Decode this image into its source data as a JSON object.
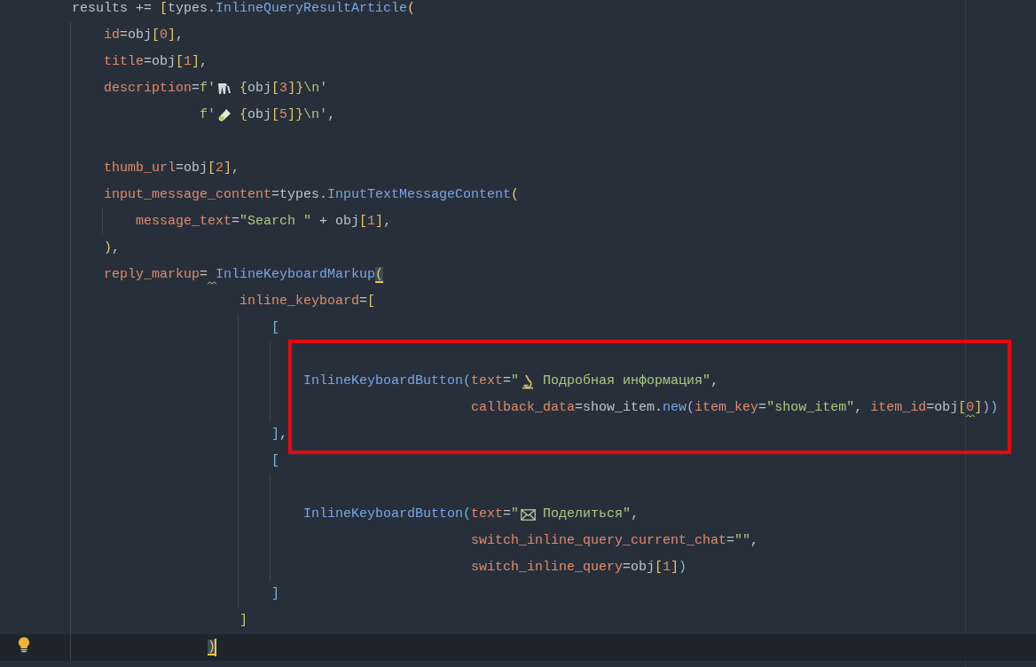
{
  "editor": {
    "lines": [
      {
        "kind": "code",
        "tokens": [
          {
            "t": "results += ",
            "kind": "plain"
          },
          {
            "t": "[",
            "kind": "b1"
          },
          {
            "t": "types.",
            "kind": "plain"
          },
          {
            "t": "InlineQueryResultArticle",
            "kind": "cls"
          },
          {
            "t": "(",
            "kind": "b1"
          }
        ]
      },
      {
        "kind": "code",
        "tokens": [
          {
            "t": "id",
            "kind": "param"
          },
          {
            "t": "=obj",
            "kind": "plain"
          },
          {
            "t": "[",
            "kind": "b1"
          },
          {
            "t": "0",
            "kind": "num"
          },
          {
            "t": "]",
            "kind": "b1"
          },
          {
            "t": ",",
            "kind": "plain"
          }
        ]
      },
      {
        "kind": "code",
        "tokens": [
          {
            "t": "title",
            "kind": "param"
          },
          {
            "t": "=obj",
            "kind": "plain"
          },
          {
            "t": "[",
            "kind": "b1"
          },
          {
            "t": "1",
            "kind": "num"
          },
          {
            "t": "]",
            "kind": "b1"
          },
          {
            "t": ",",
            "kind": "plain"
          }
        ]
      },
      {
        "kind": "code",
        "tokens": [
          {
            "t": "description",
            "kind": "param"
          },
          {
            "t": "=",
            "kind": "plain"
          },
          {
            "t": "f'",
            "kind": "str"
          },
          {
            "kind": "icon"
          },
          {
            "t": "{",
            "kind": "b1"
          },
          {
            "t": "obj",
            "kind": "plain"
          },
          {
            "t": "[",
            "kind": "b1"
          },
          {
            "t": "3",
            "kind": "num"
          },
          {
            "t": "]",
            "kind": "b1"
          },
          {
            "t": "}",
            "kind": "b1"
          },
          {
            "t": "\\n'",
            "kind": "str"
          }
        ]
      },
      {
        "kind": "code",
        "tokens": [
          {
            "t": "f'",
            "kind": "str"
          },
          {
            "kind": "icon"
          },
          {
            "t": "{",
            "kind": "b1"
          },
          {
            "t": "obj",
            "kind": "plain"
          },
          {
            "t": "[",
            "kind": "b1"
          },
          {
            "t": "5",
            "kind": "num"
          },
          {
            "t": "]",
            "kind": "b1"
          },
          {
            "t": "}",
            "kind": "b1"
          },
          {
            "t": "\\n'",
            "kind": "str"
          },
          {
            "t": ",",
            "kind": "plain"
          }
        ]
      },
      {
        "kind": "blank"
      },
      {
        "kind": "code",
        "tokens": [
          {
            "t": "thumb_url",
            "kind": "param"
          },
          {
            "t": "=obj",
            "kind": "plain"
          },
          {
            "t": "[",
            "kind": "b1"
          },
          {
            "t": "2",
            "kind": "num"
          },
          {
            "t": "]",
            "kind": "b1"
          },
          {
            "t": ",",
            "kind": "plain"
          }
        ]
      },
      {
        "kind": "code",
        "tokens": [
          {
            "t": "input_message_content",
            "kind": "param"
          },
          {
            "t": "=types.",
            "kind": "plain"
          },
          {
            "t": "InputTextMessageContent",
            "kind": "cls"
          },
          {
            "t": "(",
            "kind": "b1"
          }
        ]
      },
      {
        "kind": "code",
        "tokens": [
          {
            "t": "message_text",
            "kind": "param"
          },
          {
            "t": "=",
            "kind": "plain"
          },
          {
            "t": "\"Search \"",
            "kind": "str"
          },
          {
            "t": " + obj",
            "kind": "plain"
          },
          {
            "t": "[",
            "kind": "b1"
          },
          {
            "t": "1",
            "kind": "num"
          },
          {
            "t": "]",
            "kind": "b1"
          },
          {
            "t": ",",
            "kind": "plain"
          }
        ]
      },
      {
        "kind": "code",
        "tokens": [
          {
            "t": ")",
            "kind": "b1"
          },
          {
            "t": ",",
            "kind": "plain"
          }
        ]
      },
      {
        "kind": "code",
        "tokens": [
          {
            "t": "reply_markup",
            "kind": "param"
          },
          {
            "t": "=",
            "kind": "plain"
          },
          {
            "t": " InlineKeyboardMarkup",
            "kind": "cls",
            "warn": true
          },
          {
            "t": "(",
            "kind": "b1",
            "match": true
          }
        ]
      },
      {
        "kind": "code",
        "tokens": [
          {
            "t": "inline_keyboard",
            "kind": "param"
          },
          {
            "t": "=",
            "kind": "plain"
          },
          {
            "t": "[",
            "kind": "b1"
          }
        ]
      },
      {
        "kind": "code",
        "tokens": [
          {
            "t": "[",
            "kind": "b2"
          }
        ]
      },
      {
        "kind": "blank"
      },
      {
        "kind": "code",
        "tokens": [
          {
            "t": "InlineKeyboardButton",
            "kind": "cls"
          },
          {
            "t": "(",
            "kind": "b2"
          },
          {
            "t": "text",
            "kind": "param"
          },
          {
            "t": "=",
            "kind": "plain"
          },
          {
            "t": "\"",
            "kind": "str"
          },
          {
            "kind": "icon"
          },
          {
            "t": "Подробная информация\"",
            "kind": "str"
          },
          {
            "t": ",",
            "kind": "plain"
          }
        ]
      },
      {
        "kind": "code",
        "tokens": [
          {
            "t": "callback_data",
            "kind": "param"
          },
          {
            "t": "=show_item.",
            "kind": "plain"
          },
          {
            "t": "new",
            "kind": "cls"
          },
          {
            "t": "(",
            "kind": "b3"
          },
          {
            "t": "item_key",
            "kind": "param"
          },
          {
            "t": "=",
            "kind": "plain"
          },
          {
            "t": "\"show_item\"",
            "kind": "str"
          },
          {
            "t": ", ",
            "kind": "plain"
          },
          {
            "t": "item_id",
            "kind": "param"
          },
          {
            "t": "=obj",
            "kind": "plain"
          },
          {
            "t": "[",
            "kind": "b1"
          },
          {
            "t": "0",
            "kind": "num",
            "warn": true
          },
          {
            "t": "]",
            "kind": "b1"
          },
          {
            "t": ")",
            "kind": "b3"
          },
          {
            "t": ")",
            "kind": "b2"
          }
        ]
      },
      {
        "kind": "code",
        "tokens": [
          {
            "t": "]",
            "kind": "b2"
          },
          {
            "t": ",",
            "kind": "plain"
          }
        ]
      },
      {
        "kind": "code",
        "tokens": [
          {
            "t": "[",
            "kind": "b2"
          }
        ]
      },
      {
        "kind": "blank"
      },
      {
        "kind": "code",
        "tokens": [
          {
            "t": "InlineKeyboardButton",
            "kind": "cls"
          },
          {
            "t": "(",
            "kind": "b2"
          },
          {
            "t": "text",
            "kind": "param"
          },
          {
            "t": "=",
            "kind": "plain"
          },
          {
            "t": "\"",
            "kind": "str"
          },
          {
            "kind": "icon"
          },
          {
            "t": "Поделиться\"",
            "kind": "str"
          },
          {
            "t": ",",
            "kind": "plain"
          }
        ]
      },
      {
        "kind": "code",
        "tokens": [
          {
            "t": "switch_inline_query_current_chat",
            "kind": "param"
          },
          {
            "t": "=",
            "kind": "plain"
          },
          {
            "t": "\"\"",
            "kind": "str"
          },
          {
            "t": ",",
            "kind": "plain"
          }
        ]
      },
      {
        "kind": "code",
        "tokens": [
          {
            "t": "switch_inline_query",
            "kind": "param"
          },
          {
            "t": "=obj",
            "kind": "plain"
          },
          {
            "t": "[",
            "kind": "b1"
          },
          {
            "t": "1",
            "kind": "num"
          },
          {
            "t": "]",
            "kind": "b1"
          },
          {
            "t": ")",
            "kind": "b2"
          }
        ]
      },
      {
        "kind": "code",
        "tokens": [
          {
            "t": "]",
            "kind": "b2"
          }
        ]
      },
      {
        "kind": "code",
        "tokens": [
          {
            "t": "]",
            "kind": "b4"
          }
        ]
      },
      {
        "kind": "code",
        "current": true,
        "bulb": true,
        "tokens": [
          {
            "t": ")",
            "kind": "b1",
            "match": true,
            "caret": true
          }
        ]
      }
    ]
  },
  "annotation": {
    "kind": "frame"
  }
}
